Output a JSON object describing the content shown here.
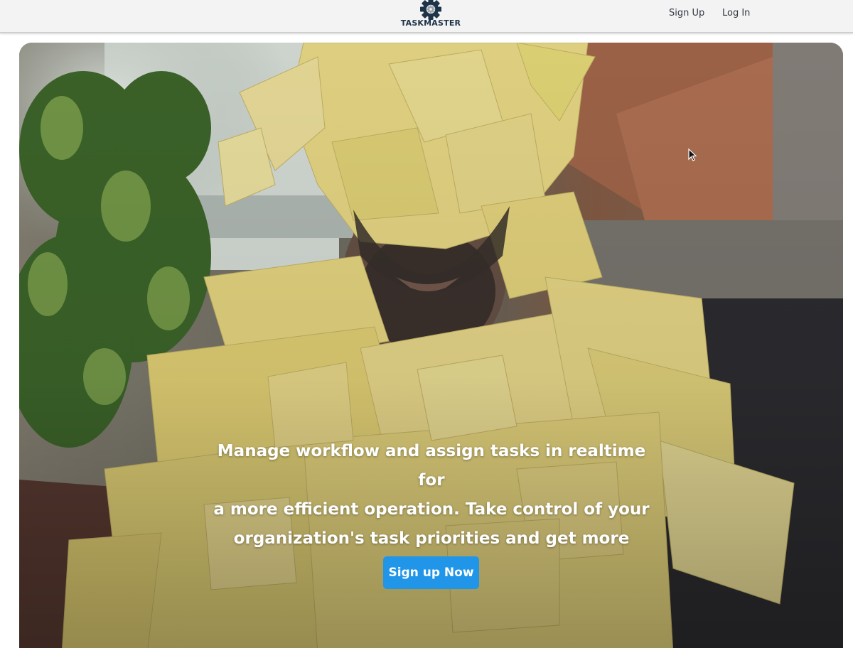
{
  "header": {
    "brand_name": "TASKMASTER",
    "brand_icon": "gear-icon",
    "nav": {
      "signup_label": "Sign Up",
      "login_label": "Log In"
    }
  },
  "hero": {
    "background": "photo-person-covered-in-sticky-notes",
    "headline_lines": [
      "Manage workflow and assign tasks in realtime for",
      "a more efficient operation. Take control of your",
      "organization's task priorities and get more done."
    ],
    "cta_label": "Sign up Now"
  },
  "colors": {
    "navbar_bg": "#f3f3f3",
    "brand": "#1e3448",
    "cta": "#2196e9",
    "sticky_note": "#f0de7e"
  },
  "icons": {
    "cursor": "mouse-pointer-icon"
  }
}
